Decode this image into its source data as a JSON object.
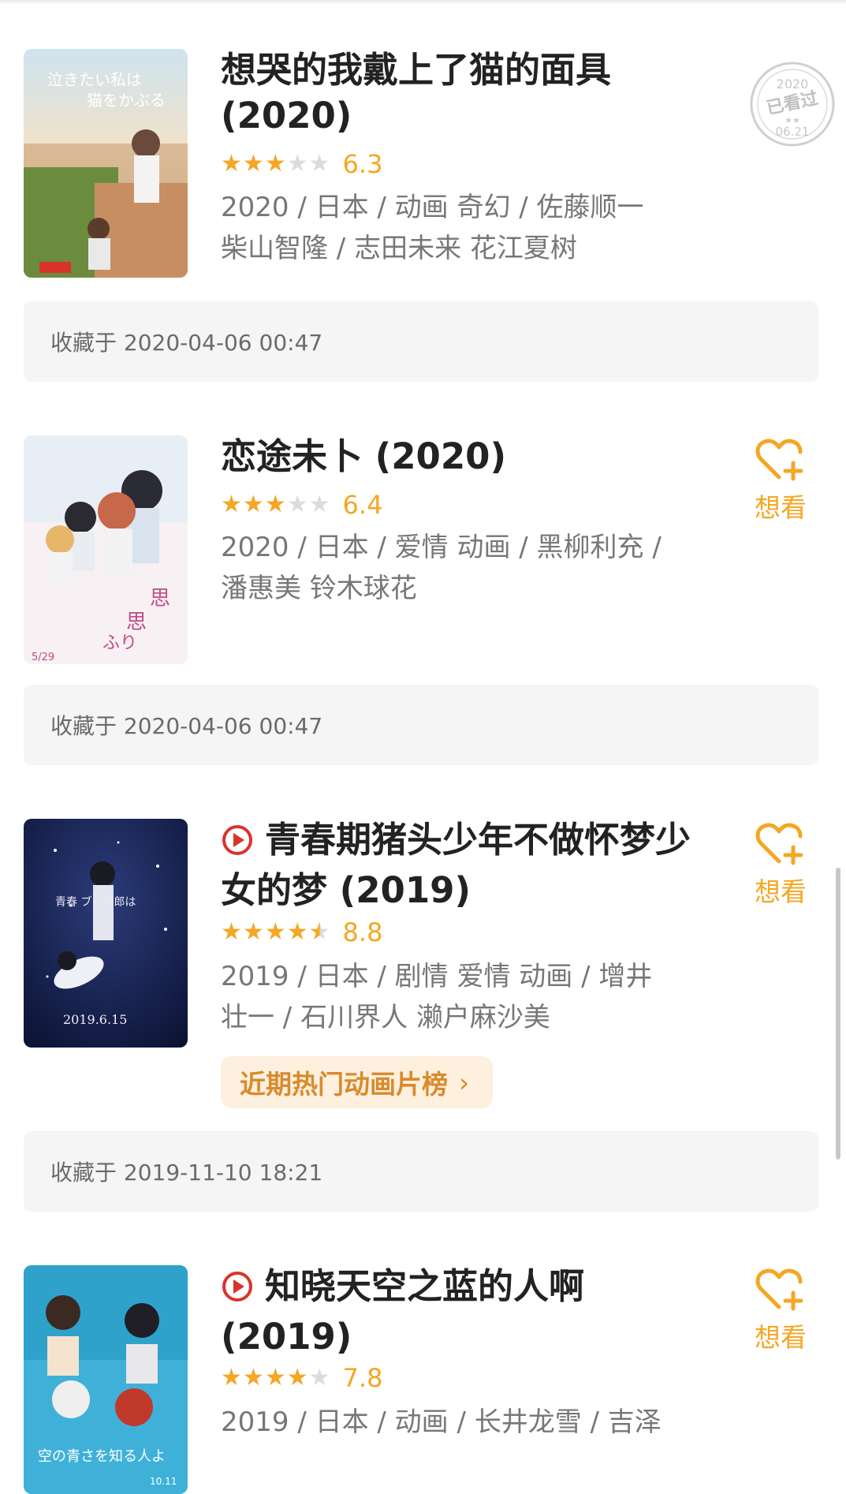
{
  "colors": {
    "accent": "#f5a623",
    "meta_text": "#777777",
    "collect_bg": "#f5f5f5"
  },
  "items": [
    {
      "title": "想哭的我戴上了猫的面具 (2020)",
      "rating": 6.3,
      "rating_text": "6.3",
      "stars_filled": 3,
      "meta_line1": "2020 / 日本 / 动画 奇幻 / 佐藤顺一",
      "meta_line2": "柴山智隆 / 志田未来 花江夏树",
      "collected": "收藏于 2020-04-06 00:47",
      "stamp": {
        "year": "2020",
        "label": "已看过",
        "date": "06.21"
      },
      "poster_icon": "poster-image"
    },
    {
      "title": "恋途未卜 (2020)",
      "rating": 6.4,
      "rating_text": "6.4",
      "stars_filled": 3,
      "meta_line1": "2020 / 日本 / 爱情 动画 / 黑柳利充 /",
      "meta_line2": "潘惠美 铃木球花",
      "collected": "收藏于 2020-04-06 00:47",
      "want_label": "想看",
      "poster_icon": "poster-image"
    },
    {
      "title": "青春期猪头少年不做怀梦少女的梦 (2019)",
      "rating": 8.8,
      "rating_text": "8.8",
      "stars_filled": 4.5,
      "meta_line1": "2019 / 日本 / 剧情 爱情 动画 / 增井",
      "meta_line2": "壮一 / 石川界人 濑户麻沙美",
      "chart_link": "近期热门动画片榜",
      "collected": "收藏于 2019-11-10 18:21",
      "want_label": "想看",
      "poster_icon": "poster-image"
    },
    {
      "title": "知晓天空之蓝的人啊 (2019)",
      "rating": 7.8,
      "rating_text": "7.8",
      "stars_filled": 4,
      "meta_line1": "2019 / 日本 / 动画 / 长井龙雪 / 吉泽",
      "want_label": "想看",
      "poster_icon": "poster-image"
    }
  ]
}
